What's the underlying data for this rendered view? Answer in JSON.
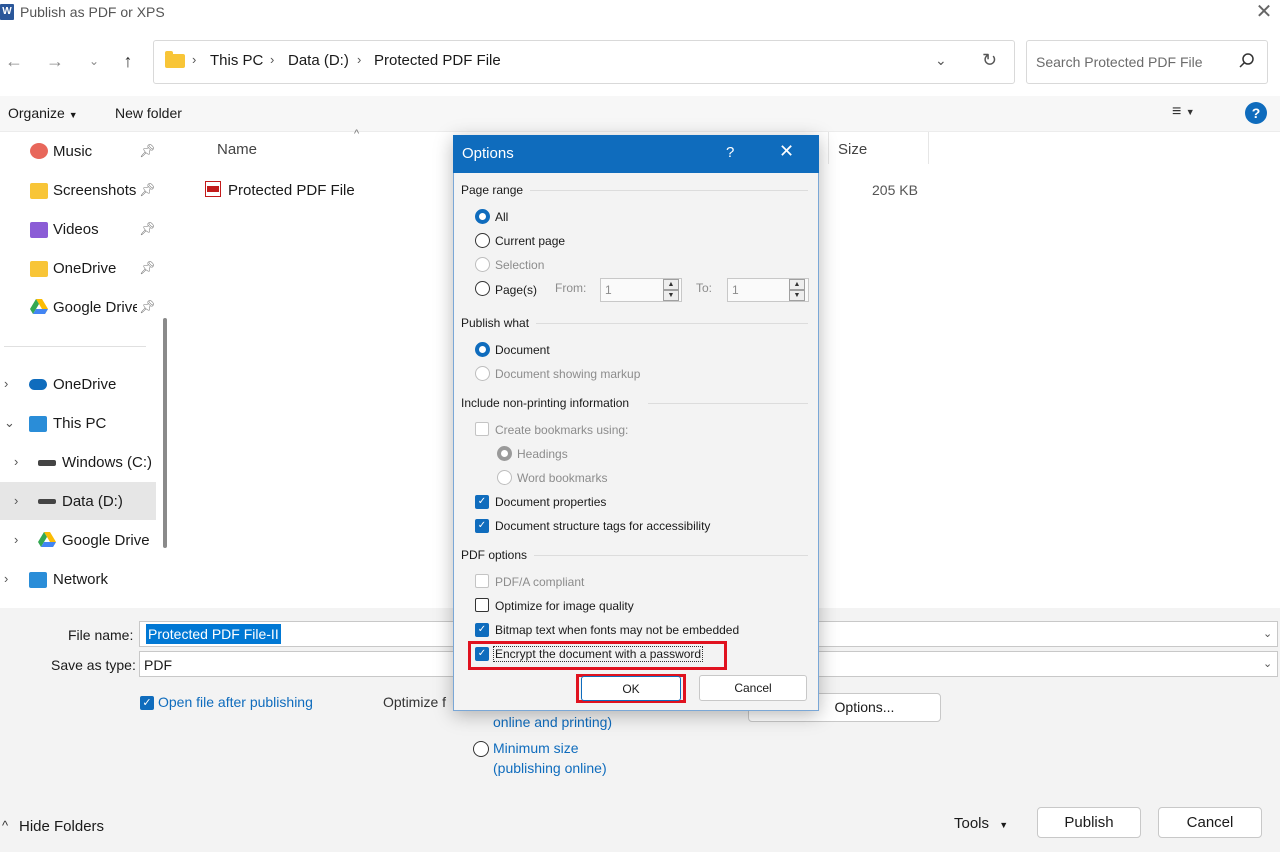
{
  "window": {
    "title": "Publish as PDF or XPS",
    "app_icon": "W"
  },
  "address": {
    "crumbs": [
      "This PC",
      "Data (D:)",
      "Protected PDF File"
    ],
    "search_placeholder": "Search Protected PDF File"
  },
  "commandbar": {
    "organize": "Organize",
    "new_folder": "New folder"
  },
  "nav": {
    "quick": [
      {
        "label": "Music",
        "icon": "music-icon"
      },
      {
        "label": "Screenshots",
        "icon": "screenshots-folder-icon"
      },
      {
        "label": "Videos",
        "icon": "videos-icon"
      },
      {
        "label": "OneDrive",
        "icon": "folder-icon"
      },
      {
        "label": "Google Drive",
        "icon": "google-drive-icon"
      }
    ],
    "tree": [
      {
        "label": "OneDrive",
        "icon": "cloud-icon"
      },
      {
        "label": "This PC",
        "icon": "pc-icon"
      },
      {
        "label": "Windows (C:)",
        "icon": "drive-c-icon"
      },
      {
        "label": "Data (D:)",
        "icon": "drive-icon"
      },
      {
        "label": "Google Drive",
        "icon": "google-drive-icon"
      },
      {
        "label": "Network",
        "icon": "network-icon"
      }
    ]
  },
  "filelist": {
    "columns": {
      "name": "Name",
      "size": "Size"
    },
    "rows": [
      {
        "name": "Protected PDF File",
        "size": "205 KB"
      }
    ]
  },
  "save": {
    "file_name_label": "File name:",
    "file_name_value": "Protected PDF File-II",
    "type_label": "Save as type:",
    "type_value": "PDF",
    "open_after": "Open file after publishing",
    "optimize_label": "Optimize f",
    "std_line2": "online and printing)",
    "min_size_line1": "Minimum size",
    "min_size_line2": "(publishing online)",
    "options_btn": "Options..."
  },
  "footer": {
    "hide_folders": "Hide Folders",
    "tools": "Tools",
    "publish": "Publish",
    "cancel": "Cancel"
  },
  "dialog": {
    "title": "Options",
    "help": "?",
    "page_range": {
      "heading": "Page range",
      "all": "All",
      "current": "Current page",
      "selection": "Selection",
      "pages": "Page(s)",
      "from_label": "From:",
      "from_value": "1",
      "to_label": "To:",
      "to_value": "1"
    },
    "publish_what": {
      "heading": "Publish what",
      "document": "Document",
      "markup": "Document showing markup"
    },
    "nonprinting": {
      "heading": "Include non-printing information",
      "bookmarks": "Create bookmarks using:",
      "headings": "Headings",
      "word_bookmarks": "Word bookmarks",
      "properties": "Document properties",
      "structure_tags": "Document structure tags for accessibility"
    },
    "pdf_options": {
      "heading": "PDF options",
      "pdfa": "PDF/A compliant",
      "optimize_image": "Optimize for image quality",
      "bitmap_text": "Bitmap text when fonts may not be embedded",
      "encrypt": "Encrypt the document with a password"
    },
    "ok": "OK",
    "cancel": "Cancel"
  },
  "colors": {
    "accent": "#0f6cbd",
    "highlight": "#e0121f"
  }
}
